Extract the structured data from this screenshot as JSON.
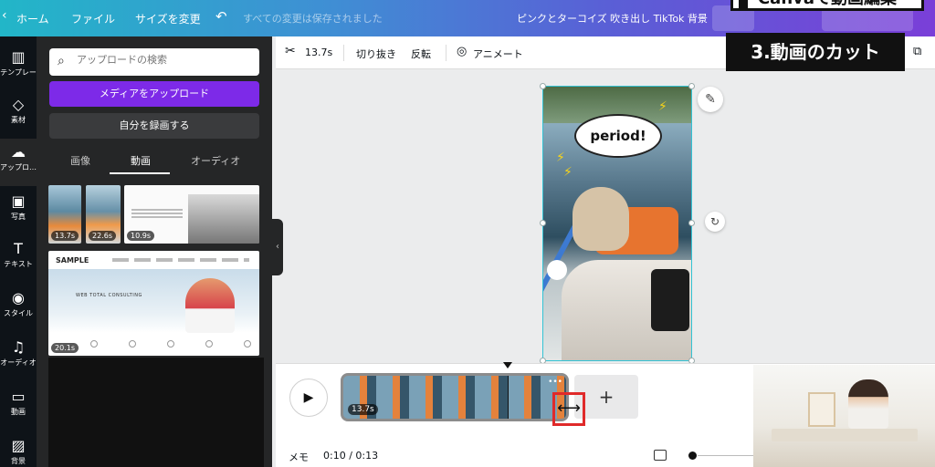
{
  "topbar": {
    "back_icon": "chevron-left-icon",
    "home": "ホーム",
    "file": "ファイル",
    "resize": "サイズを変更",
    "undo_icon": "undo-icon",
    "saved": "すべての変更は保存されました",
    "doc_title": "ピンクとターコイズ 吹き出し TikTok 背景",
    "overlay_title": "Canvaで動画編集"
  },
  "rail": {
    "items": [
      {
        "icon": "template-icon",
        "label": "テンプレー"
      },
      {
        "icon": "elements-icon",
        "label": "素材"
      },
      {
        "icon": "upload-icon",
        "label": "アップロ…"
      },
      {
        "icon": "photo-icon",
        "label": "写真"
      },
      {
        "icon": "text-icon",
        "label": "テキスト"
      },
      {
        "icon": "style-icon",
        "label": "スタイル"
      },
      {
        "icon": "audio-icon",
        "label": "オーディオ"
      },
      {
        "icon": "video-icon",
        "label": "動画"
      },
      {
        "icon": "background-icon",
        "label": "背景"
      }
    ]
  },
  "panel": {
    "search_placeholder": "アップロードの検索",
    "upload_button": "メディアをアップロード",
    "record_button": "自分を録画する",
    "tabs": [
      "画像",
      "動画",
      "オーディオ"
    ],
    "active_tab": "動画",
    "thumbs": [
      {
        "duration": "13.7s"
      },
      {
        "duration": "22.6s"
      },
      {
        "duration": "10.9s"
      },
      {
        "duration": "20.1s"
      }
    ],
    "sample_logo": "SAMPLE",
    "sample_hero": "WEB TOTAL CONSULTING"
  },
  "editor_toolbar": {
    "duration": "13.7s",
    "crop": "切り抜き",
    "flip": "反転",
    "animate": "アニメート",
    "cut_label": "3.動画のカット"
  },
  "canvas": {
    "bubble_text": "period!"
  },
  "timeline": {
    "clip_duration": "13.7s",
    "more": "•••",
    "memo": "メモ",
    "time": "0:10 / 0:13",
    "add": "+"
  },
  "colors": {
    "accent_purple": "#7d2ae8",
    "selection": "#33c3d4",
    "trim_highlight": "#e02a2a"
  }
}
